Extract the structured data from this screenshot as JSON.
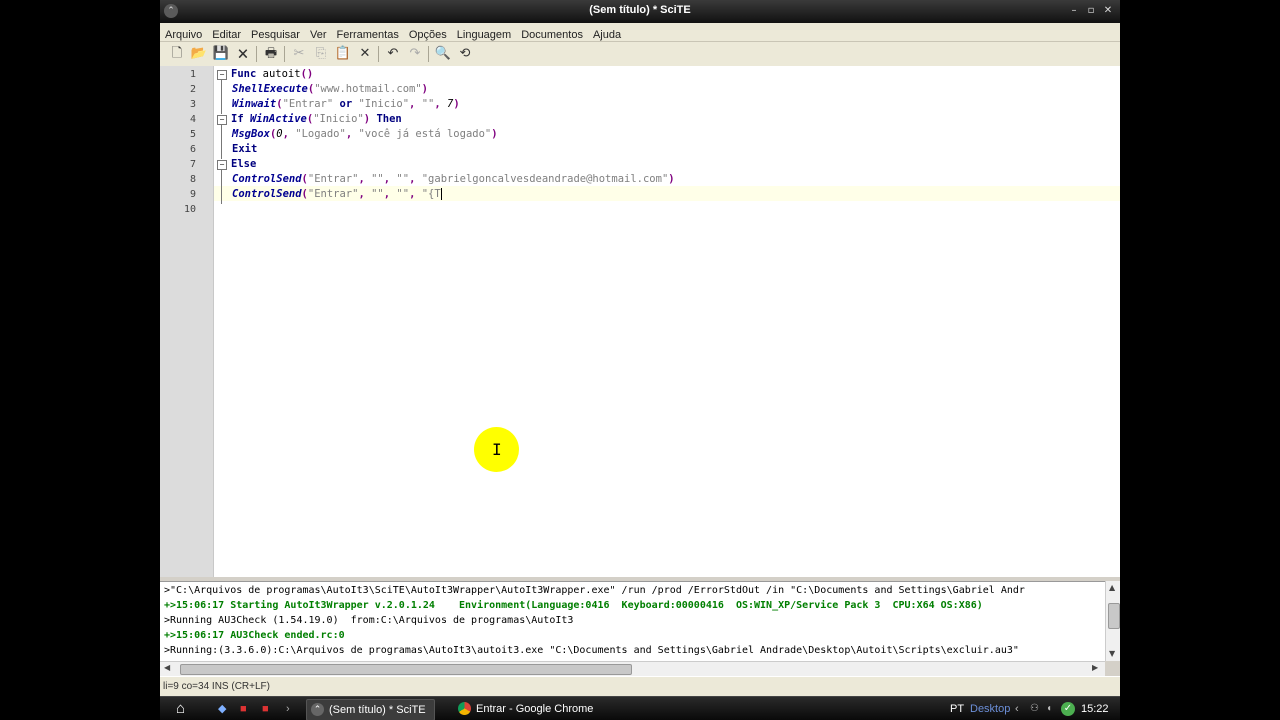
{
  "window": {
    "title": "(Sem título) * SciTE"
  },
  "menu": [
    "Arquivo",
    "Editar",
    "Pesquisar",
    "Ver",
    "Ferramentas",
    "Opções",
    "Linguagem",
    "Documentos",
    "Ajuda"
  ],
  "editor": {
    "line_numbers": [
      "1",
      "2",
      "3",
      "4",
      "5",
      "6",
      "7",
      "8",
      "9",
      "10"
    ],
    "lines": [
      [
        {
          "t": "Func",
          "c": "kw"
        },
        {
          "t": " autoit",
          "c": ""
        },
        {
          "t": "()",
          "c": "op"
        }
      ],
      [
        {
          "t": "ShellExecute",
          "c": "fn"
        },
        {
          "t": "(",
          "c": "op"
        },
        {
          "t": "\"www.hotmail.com\"",
          "c": "str"
        },
        {
          "t": ")",
          "c": "op"
        }
      ],
      [
        {
          "t": "Winwait",
          "c": "fn"
        },
        {
          "t": "(",
          "c": "op"
        },
        {
          "t": "\"Entrar\"",
          "c": "str"
        },
        {
          "t": " or ",
          "c": "kw"
        },
        {
          "t": "\"Inicio\"",
          "c": "str"
        },
        {
          "t": ", ",
          "c": "op"
        },
        {
          "t": "\"\"",
          "c": "str"
        },
        {
          "t": ", ",
          "c": "op"
        },
        {
          "t": "7",
          "c": "num"
        },
        {
          "t": ")",
          "c": "op"
        }
      ],
      [
        {
          "t": "If ",
          "c": "kw"
        },
        {
          "t": "WinActive",
          "c": "fn"
        },
        {
          "t": "(",
          "c": "op"
        },
        {
          "t": "\"Inicio\"",
          "c": "str"
        },
        {
          "t": ") ",
          "c": "op"
        },
        {
          "t": "Then",
          "c": "kw"
        }
      ],
      [
        {
          "t": "MsgBox",
          "c": "fn"
        },
        {
          "t": "(",
          "c": "op"
        },
        {
          "t": "0",
          "c": "num"
        },
        {
          "t": ", ",
          "c": "op"
        },
        {
          "t": "\"Logado\"",
          "c": "str"
        },
        {
          "t": ", ",
          "c": "op"
        },
        {
          "t": "\"você já está logado\"",
          "c": "str"
        },
        {
          "t": ")",
          "c": "op"
        }
      ],
      [
        {
          "t": "Exit",
          "c": "kw"
        }
      ],
      [
        {
          "t": "Else",
          "c": "kw"
        }
      ],
      [
        {
          "t": "ControlSend",
          "c": "fn"
        },
        {
          "t": "(",
          "c": "op"
        },
        {
          "t": "\"Entrar\"",
          "c": "str"
        },
        {
          "t": ", ",
          "c": "op"
        },
        {
          "t": "\"\"",
          "c": "str"
        },
        {
          "t": ", ",
          "c": "op"
        },
        {
          "t": "\"\"",
          "c": "str"
        },
        {
          "t": ", ",
          "c": "op"
        },
        {
          "t": "\"gabrielgoncalvesdeandrade@hotmail.com\"",
          "c": "str"
        },
        {
          "t": ")",
          "c": "op"
        }
      ],
      [
        {
          "t": "ControlSend",
          "c": "fn"
        },
        {
          "t": "(",
          "c": "op"
        },
        {
          "t": "\"Entrar\"",
          "c": "str"
        },
        {
          "t": ", ",
          "c": "op"
        },
        {
          "t": "\"\"",
          "c": "str"
        },
        {
          "t": ", ",
          "c": "op"
        },
        {
          "t": "\"\"",
          "c": "str"
        },
        {
          "t": ", ",
          "c": "op"
        },
        {
          "t": "\"{T",
          "c": "str"
        }
      ],
      []
    ]
  },
  "output": {
    "lines": [
      {
        "text": ">\"C:\\Arquivos de programas\\AutoIt3\\SciTE\\AutoIt3Wrapper\\AutoIt3Wrapper.exe\" /run /prod /ErrorStdOut /in \"C:\\Documents and Settings\\Gabriel Andr",
        "style": ""
      },
      {
        "text": "+>15:06:17 Starting AutoIt3Wrapper v.2.0.1.24    Environment(Language:0416  Keyboard:00000416  OS:WIN_XP/Service Pack 3  CPU:X64 OS:X86)",
        "style": "green"
      },
      {
        "text": ">Running AU3Check (1.54.19.0)  from:C:\\Arquivos de programas\\AutoIt3",
        "style": ""
      },
      {
        "text": "+>15:06:17 AU3Check ended.rc:0",
        "style": "green"
      },
      {
        "text": ">Running:(3.3.6.0):C:\\Arquivos de programas\\AutoIt3\\autoit3.exe \"C:\\Documents and Settings\\Gabriel Andrade\\Desktop\\Autoit\\Scripts\\excluir.au3\"",
        "style": ""
      }
    ]
  },
  "status": {
    "text": "li=9 co=34 INS (CR+LF)"
  },
  "taskbar": {
    "windows": [
      {
        "label": "(Sem título) * SciTE",
        "active": true
      },
      {
        "label": "Entrar - Google Chrome",
        "active": false
      }
    ],
    "lang": "PT",
    "desktop": "Desktop",
    "clock": "15:22"
  }
}
